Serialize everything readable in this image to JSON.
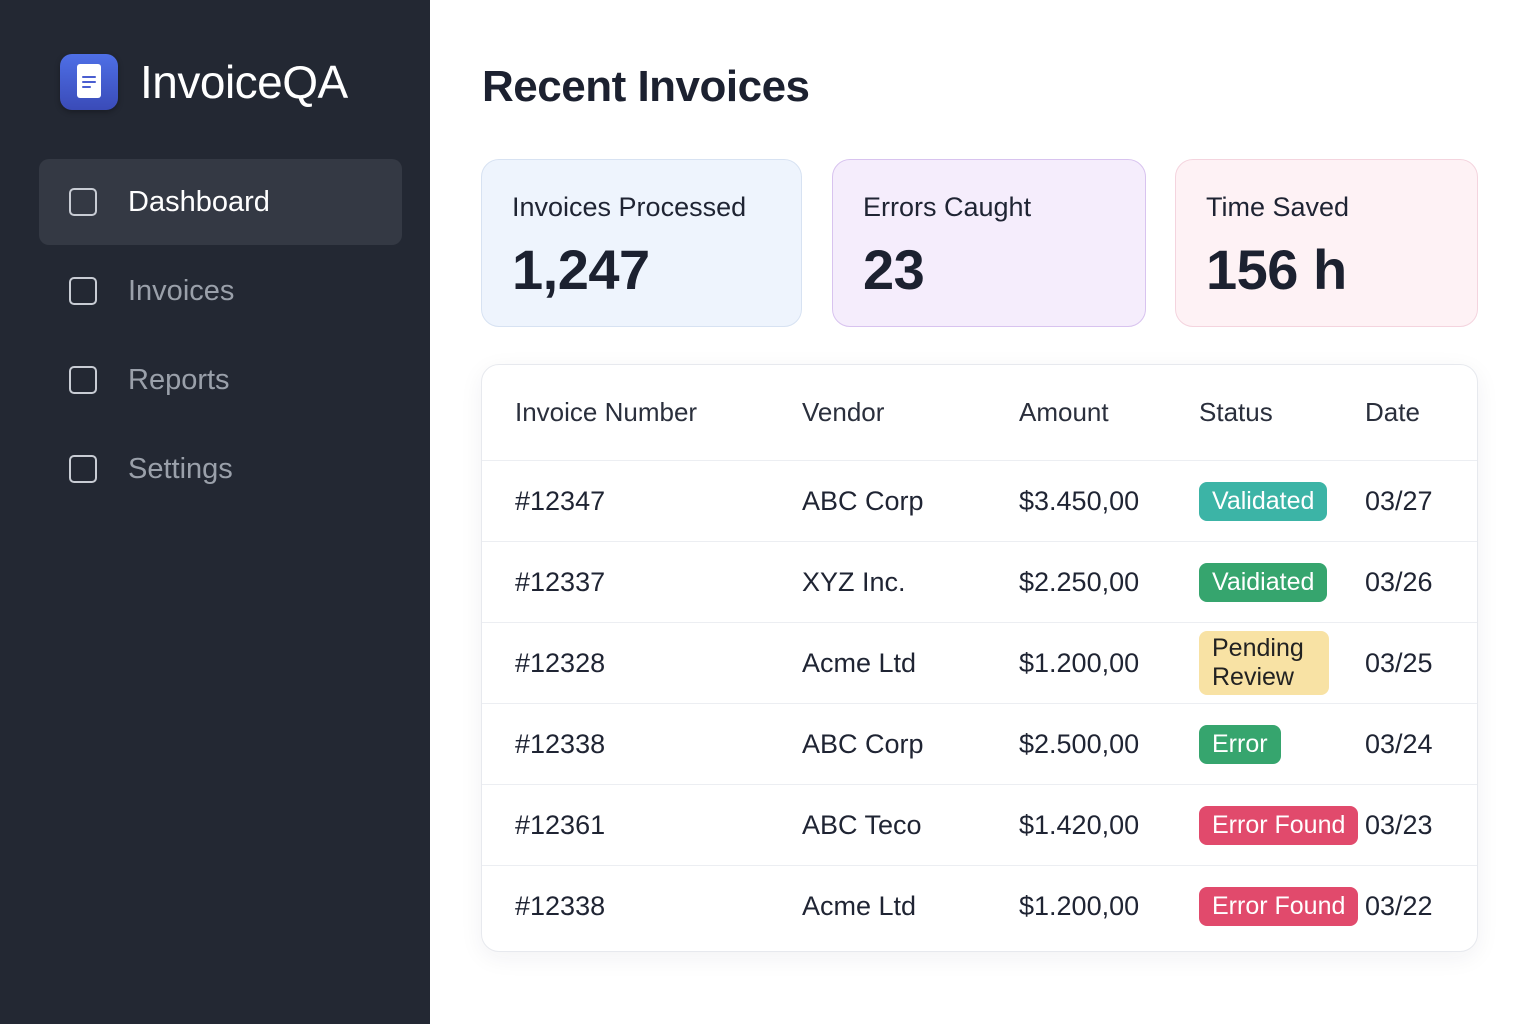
{
  "app": {
    "name": "InvoiceQA"
  },
  "sidebar": {
    "items": [
      {
        "label": "Dashboard",
        "active": true
      },
      {
        "label": "Invoices",
        "active": false
      },
      {
        "label": "Reports",
        "active": false
      },
      {
        "label": "Settings",
        "active": false
      }
    ]
  },
  "main": {
    "title": "Recent Invoices",
    "stats": [
      {
        "label": "Invoices Processed",
        "value": "1,247"
      },
      {
        "label": "Errors Caught",
        "value": "23"
      },
      {
        "label": "Time Saved",
        "value": "156 h"
      }
    ],
    "table": {
      "headers": [
        "Invoice Number",
        "Vendor",
        "Amount",
        "Status",
        "Date"
      ],
      "rows": [
        {
          "number": "#12347",
          "vendor": "ABC Corp",
          "amount": "$3.450,00",
          "status": "Validated",
          "status_color": "#3cb4a6",
          "date": "03/27"
        },
        {
          "number": "#12337",
          "vendor": "XYZ Inc.",
          "amount": "$2.250,00",
          "status": "Vaidiated",
          "status_color": "#36a56e",
          "date": "03/26"
        },
        {
          "number": "#12328",
          "vendor": "Acme Ltd",
          "amount": "$1.200,00",
          "status": "Pending Review",
          "status_color": "#f8e2a4",
          "date": "03/25"
        },
        {
          "number": "#12338",
          "vendor": "ABC Corp",
          "amount": "$2.500,00",
          "status": "Error",
          "status_color": "#36a56e",
          "date": "03/24"
        },
        {
          "number": "#12361",
          "vendor": "ABC Teco",
          "amount": "$1.420,00",
          "status": "Error Found",
          "status_color": "#e14a6c",
          "date": "03/23"
        },
        {
          "number": "#12338",
          "vendor": "Acme Ltd",
          "amount": "$1.200,00",
          "status": "Error Found",
          "status_color": "#e14a6c",
          "date": "03/22"
        }
      ]
    }
  },
  "colors": {
    "sidebar_bg": "#232833",
    "sidebar_active": "#343944",
    "accent": "#4e6fe6"
  },
  "icons": {
    "logo": "document-icon",
    "nav_item": "checkbox-icon"
  }
}
